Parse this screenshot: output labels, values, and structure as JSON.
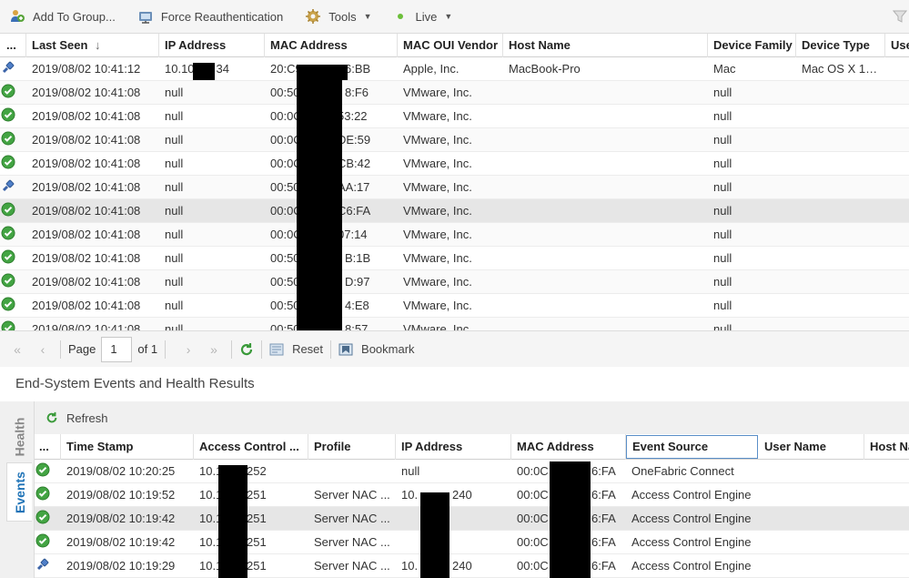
{
  "toolbar": {
    "add_to_group": "Add To Group...",
    "force_reauth": "Force Reauthentication",
    "tools": "Tools",
    "live": "Live"
  },
  "grid": {
    "headers": [
      "...",
      "Last Seen",
      "IP Address",
      "MAC Address",
      "MAC OUI Vendor",
      "Host Name",
      "Device Family",
      "Device Type",
      "Use"
    ],
    "sort_indicator": "↓",
    "rows": [
      {
        "status": "plug",
        "last_seen": "2019/08/02 10:41:12",
        "ip": "10.10",
        "ip_tail": "34",
        "mac": "20:C9",
        "mac_tail": "6:BB",
        "vendor": "Apple, Inc.",
        "host": "MacBook-Pro",
        "family": "Mac",
        "type": "Mac OS X 1…"
      },
      {
        "status": "ok",
        "last_seen": "2019/08/02 10:41:08",
        "ip": "null",
        "mac": "00:50",
        "mac_tail": "8:F6",
        "vendor": "VMware, Inc.",
        "host": "",
        "family": "null",
        "type": ""
      },
      {
        "status": "ok",
        "last_seen": "2019/08/02 10:41:08",
        "ip": "null",
        "mac": "00:0C",
        "mac_tail": "53:22",
        "vendor": "VMware, Inc.",
        "host": "",
        "family": "null",
        "type": ""
      },
      {
        "status": "ok",
        "last_seen": "2019/08/02 10:41:08",
        "ip": "null",
        "mac": "00:0C",
        "mac_tail": "DE:59",
        "vendor": "VMware, Inc.",
        "host": "",
        "family": "null",
        "type": ""
      },
      {
        "status": "ok",
        "last_seen": "2019/08/02 10:41:08",
        "ip": "null",
        "mac": "00:0C",
        "mac_tail": "CB:42",
        "vendor": "VMware, Inc.",
        "host": "",
        "family": "null",
        "type": ""
      },
      {
        "status": "plug",
        "last_seen": "2019/08/02 10:41:08",
        "ip": "null",
        "mac": "00:50",
        "mac_tail": "AA:17",
        "vendor": "VMware, Inc.",
        "host": "",
        "family": "null",
        "type": ""
      },
      {
        "status": "ok",
        "last_seen": "2019/08/02 10:41:08",
        "ip": "null",
        "mac": "00:0C",
        "mac_tail": "C6:FA",
        "vendor": "VMware, Inc.",
        "host": "",
        "family": "null",
        "type": ""
      },
      {
        "status": "ok",
        "last_seen": "2019/08/02 10:41:08",
        "ip": "null",
        "mac": "00:0C",
        "mac_tail": "07:14",
        "vendor": "VMware, Inc.",
        "host": "",
        "family": "null",
        "type": ""
      },
      {
        "status": "ok",
        "last_seen": "2019/08/02 10:41:08",
        "ip": "null",
        "mac": "00:50",
        "mac_tail": "B:1B",
        "vendor": "VMware, Inc.",
        "host": "",
        "family": "null",
        "type": ""
      },
      {
        "status": "ok",
        "last_seen": "2019/08/02 10:41:08",
        "ip": "null",
        "mac": "00:50",
        "mac_tail": "D:97",
        "vendor": "VMware, Inc.",
        "host": "",
        "family": "null",
        "type": ""
      },
      {
        "status": "ok",
        "last_seen": "2019/08/02 10:41:08",
        "ip": "null",
        "mac": "00:50",
        "mac_tail": "4:E8",
        "vendor": "VMware, Inc.",
        "host": "",
        "family": "null",
        "type": ""
      },
      {
        "status": "ok",
        "last_seen": "2019/08/02 10:41:08",
        "ip": "null",
        "mac": "00:50",
        "mac_tail": "8:57",
        "vendor": "VMware, Inc.",
        "host": "",
        "family": "null",
        "type": ""
      }
    ]
  },
  "pager": {
    "page_label": "Page",
    "page_value": "1",
    "of_label": "of 1",
    "reset": "Reset",
    "bookmark": "Bookmark"
  },
  "section": {
    "title": "End-System Events and Health Results"
  },
  "lower": {
    "tab_health": "Health",
    "tab_events": "Events",
    "refresh": "Refresh",
    "headers": [
      "...",
      "Time Stamp",
      "Access Control ...",
      "Profile",
      "IP Address",
      "MAC Address",
      "Event Source",
      "User Name",
      "Host Na"
    ],
    "rows": [
      {
        "status": "ok",
        "time": "2019/08/02 10:20:25",
        "acl": "10.1",
        "acl_tail": "252",
        "profile": "",
        "ip": "null",
        "ip_tail": "",
        "mac": "00:0C",
        "mac_tail": "6:FA",
        "source": "OneFabric Connect"
      },
      {
        "status": "ok",
        "time": "2019/08/02 10:19:52",
        "acl": "10.1",
        "acl_tail": "251",
        "profile": "Server NAC ...",
        "ip": "10.",
        "ip_tail": "240",
        "mac": "00:0C",
        "mac_tail": "6:FA",
        "source": "Access Control Engine"
      },
      {
        "status": "ok",
        "time": "2019/08/02 10:19:42",
        "acl": "10.1",
        "acl_tail": "251",
        "profile": "Server NAC ...",
        "ip": "",
        "ip_tail": "",
        "mac": "00:0C",
        "mac_tail": "6:FA",
        "source": "Access Control Engine"
      },
      {
        "status": "ok",
        "time": "2019/08/02 10:19:42",
        "acl": "10.1",
        "acl_tail": "251",
        "profile": "Server NAC ...",
        "ip": "",
        "ip_tail": "",
        "mac": "00:0C",
        "mac_tail": "6:FA",
        "source": "Access Control Engine"
      },
      {
        "status": "plug",
        "time": "2019/08/02 10:19:29",
        "acl": "10.1",
        "acl_tail": "251",
        "profile": "Server NAC ...",
        "ip": "10.",
        "ip_tail": "240",
        "mac": "00:0C",
        "mac_tail": "6:FA",
        "source": "Access Control Engine"
      }
    ]
  }
}
